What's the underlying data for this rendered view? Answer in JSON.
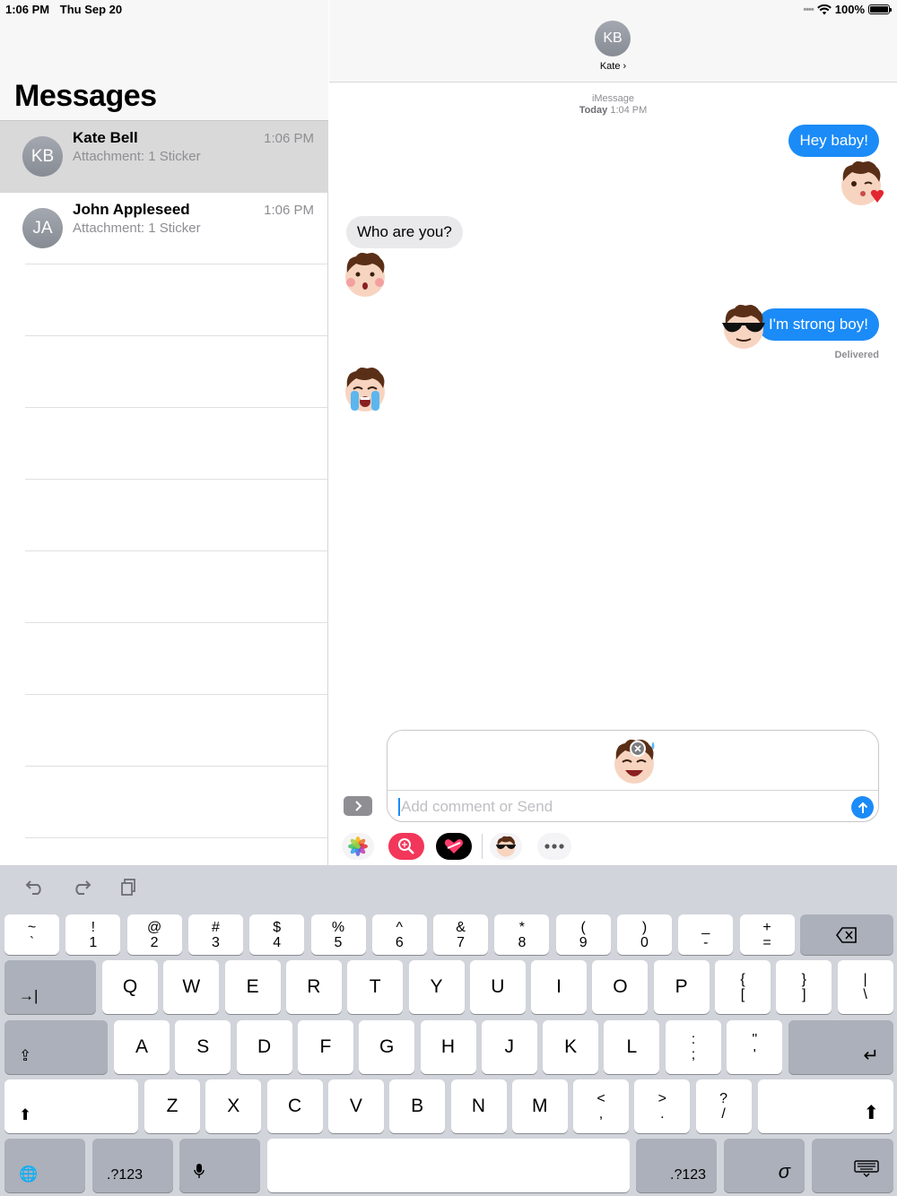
{
  "status_bar": {
    "time": "1:06 PM",
    "date": "Thu Sep 20",
    "battery": "100%"
  },
  "sidebar": {
    "title": "Messages",
    "conversations": [
      {
        "initials": "KB",
        "name": "Kate Bell",
        "preview": "Attachment: 1 Sticker",
        "time": "1:06 PM",
        "selected": true
      },
      {
        "initials": "JA",
        "name": "John Appleseed",
        "preview": "Attachment: 1 Sticker",
        "time": "1:06 PM",
        "selected": false
      }
    ]
  },
  "chat_header": {
    "initials": "KB",
    "contact": "Kate ›"
  },
  "chat": {
    "service": "iMessage",
    "timestamp_day": "Today",
    "timestamp_time": "1:04 PM",
    "messages": [
      {
        "from": "me",
        "text": "Hey baby!"
      },
      {
        "from": "them",
        "text": "Who are you?"
      },
      {
        "from": "me",
        "text": "I'm strong boy!"
      }
    ],
    "status": "Delivered"
  },
  "compose": {
    "placeholder": "Add comment or Send"
  },
  "app_strip": {
    "icons": [
      "photos-app-icon",
      "search-images-app-icon",
      "digital-touch-app-icon",
      "sticker-pack-app-icon",
      "more-apps-icon"
    ]
  },
  "keyboard": {
    "number_row": [
      [
        "~",
        "`"
      ],
      [
        "!",
        "1"
      ],
      [
        "@",
        "2"
      ],
      [
        "#",
        "3"
      ],
      [
        "$",
        "4"
      ],
      [
        "%",
        "5"
      ],
      [
        "^",
        "6"
      ],
      [
        "&",
        "7"
      ],
      [
        "*",
        "8"
      ],
      [
        "(",
        "9"
      ],
      [
        ")",
        "0"
      ],
      [
        "_",
        "-"
      ],
      [
        "+",
        "="
      ]
    ],
    "row_q": [
      "Q",
      "W",
      "E",
      "R",
      "T",
      "Y",
      "U",
      "I",
      "O",
      "P"
    ],
    "row_q_extra": [
      [
        "{",
        "["
      ],
      [
        "}",
        "]"
      ],
      [
        "|",
        "\\"
      ]
    ],
    "row_a": [
      "A",
      "S",
      "D",
      "F",
      "G",
      "H",
      "J",
      "K",
      "L"
    ],
    "row_a_extra": [
      [
        ":",
        ";"
      ],
      [
        "\"",
        "'"
      ]
    ],
    "row_z": [
      "Z",
      "X",
      "C",
      "V",
      "B",
      "N",
      "M"
    ],
    "row_z_extra": [
      [
        "<",
        ","
      ],
      [
        ">",
        "."
      ],
      [
        "?",
        "/"
      ]
    ],
    "numbers_label": ".?123"
  },
  "colors": {
    "imessage_blue": "#1b8bf7",
    "incoming_gray": "#e9e9eb",
    "keyboard_bg": "#d1d4da"
  }
}
